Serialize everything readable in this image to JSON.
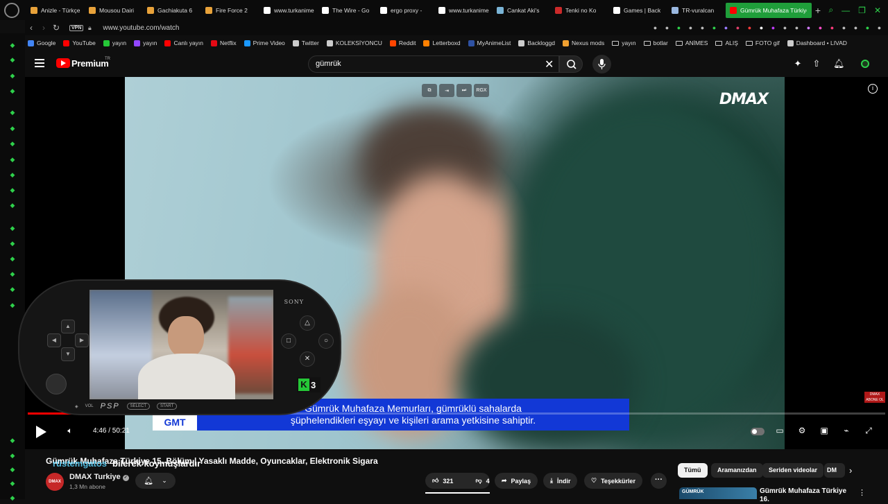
{
  "tabs": [
    {
      "title": "Anizle - Türkçe",
      "color": "#e8a23a"
    },
    {
      "title": "Mousou Dairi",
      "color": "#e8a23a"
    },
    {
      "title": "Gachiakuta 6",
      "color": "#e8a23a"
    },
    {
      "title": "Fire Force 2",
      "color": "#e8a23a"
    },
    {
      "title": "www.turkanime",
      "color": "#ffffff"
    },
    {
      "title": "The Wire - Go",
      "color": "#ffffff"
    },
    {
      "title": "ergo proxy -",
      "color": "#ffffff"
    },
    {
      "title": "www.turkanime",
      "color": "#ffffff"
    },
    {
      "title": "Cankat Aki's",
      "color": "#7ab4d6"
    },
    {
      "title": "Tenki no Ko",
      "color": "#cc2a2a"
    },
    {
      "title": "Games | Back",
      "color": "#ffffff"
    },
    {
      "title": "TR-vuralcan",
      "color": "#9ab8e0"
    },
    {
      "title": "Gümrük Muhafaza Türkiye",
      "color": "#ff0000",
      "active": true
    }
  ],
  "address": {
    "vpn": "VPN",
    "url": "www.youtube.com/watch"
  },
  "bookmarks": [
    {
      "label": "Google",
      "color": "#4285f4"
    },
    {
      "label": "YouTube",
      "color": "#ff0000"
    },
    {
      "label": "yayın",
      "color": "#25c837"
    },
    {
      "label": "yayın",
      "color": "#9146ff"
    },
    {
      "label": "Canlı yayın",
      "color": "#ff0000"
    },
    {
      "label": "Netflix",
      "color": "#e50914"
    },
    {
      "label": "Prime Video",
      "color": "#1a98ff"
    },
    {
      "label": "Twitter",
      "color": "#cccccc"
    },
    {
      "label": "KOLEKSİYONCU",
      "color": "#cccccc"
    },
    {
      "label": "Reddit",
      "color": "#ff4500"
    },
    {
      "label": "Letterboxd",
      "color": "#ff8000"
    },
    {
      "label": "MyAnimeList",
      "color": "#2e51a2"
    },
    {
      "label": "Backloggd",
      "color": "#cccccc"
    },
    {
      "label": "Nexus mods",
      "color": "#f0a030"
    },
    {
      "label": "yayın",
      "folder": true
    },
    {
      "label": "botlar",
      "folder": true
    },
    {
      "label": "ANİMES",
      "folder": true
    },
    {
      "label": "ALIŞ",
      "folder": true
    },
    {
      "label": "FOTO gif",
      "folder": true
    },
    {
      "label": "Dashboard • LIVAD",
      "color": "#cccccc"
    }
  ],
  "header": {
    "logo": "Premium",
    "region": "TR",
    "search_value": "gümrük"
  },
  "player": {
    "channel_logo": "DMAX",
    "subtitle_line1": "Gümrük Muhafaza Memurları, gümrüklü sahalarda",
    "subtitle_line2": "şüphelendikleri eşyayı ve kişileri arama yetkisine sahiptir.",
    "gmt_strip": "GMT",
    "corner_badge": "DMAX ABONE OL",
    "overlay_btn_label": "RGX",
    "time": "4:46 / 50:21",
    "progress": 0.095
  },
  "psp": {
    "brand": "SONY",
    "vol": "VOL",
    "psp_logo": "PSP",
    "select": "SELECT",
    "start": "START",
    "k3": "3"
  },
  "video": {
    "title": "Gümrük Muhafaza Türkiye 15. Bölüm | Yasaklı Madde, Oyuncaklar, Elektronik Sigara",
    "overlay_user": "rüstemgatos",
    "overlay_text": "bilerek koymuşlardır",
    "channel": "DMAX Turkiye",
    "channel_avatar": "DMAX",
    "subs": "1,3 Mn abone",
    "likes": "321",
    "dislikes": "4",
    "share": "Paylaş",
    "download": "İndir",
    "thanks": "Teşekkürler"
  },
  "chips": [
    "Tümü",
    "Aramanızdan",
    "Seriden videolar",
    "DM"
  ],
  "recommendation": {
    "title": "Gümrük Muhafaza Türkiye 16.",
    "thumb_label": "GÜMRÜK"
  }
}
